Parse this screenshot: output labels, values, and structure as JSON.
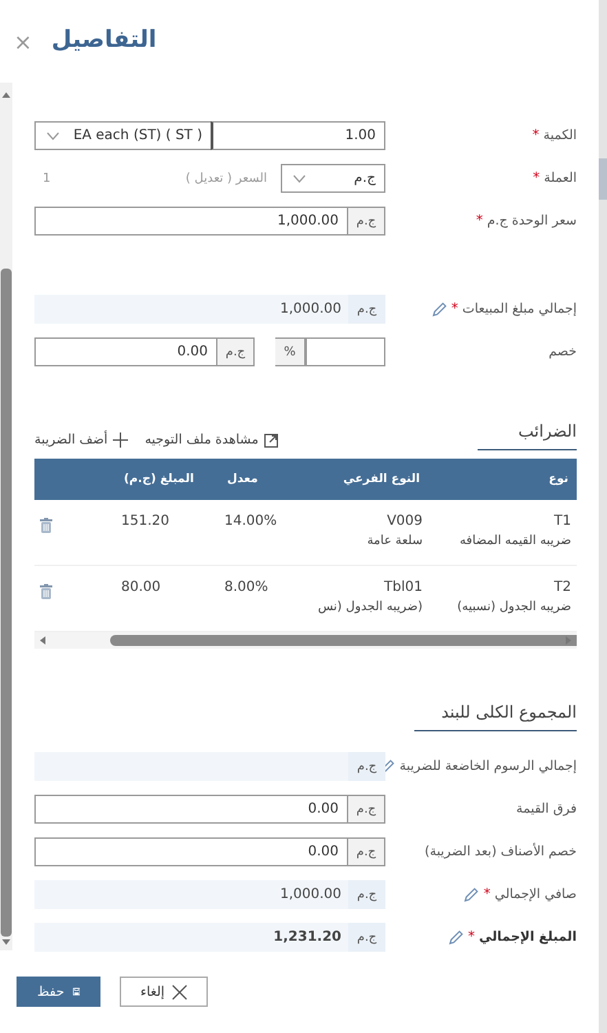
{
  "title": "التفاصيل",
  "close": "×",
  "fields": [
    {
      "kind": "unit_qty",
      "label": "الكمية",
      "mark": "*",
      "value": "1.00",
      "unit": "EA each (ST) ( ST )"
    },
    {
      "kind": "currency",
      "label": "العملة",
      "mark": "*",
      "value": "ج.م",
      "rate_label": "السعر ( تعديل )",
      "rate_value": "1",
      "rate_disabled": true
    },
    {
      "kind": "addon",
      "label": "سعر الوحدة ج.م",
      "mark": "*",
      "addon": "ج.م",
      "value": "1,000.00"
    },
    {
      "kind": "readonly",
      "label": "إجمالي مبلغ المبيعات",
      "mark": "*",
      "addon": "ج.م",
      "value": "1,000.00"
    },
    {
      "kind": "discount",
      "label": "خصم",
      "percent": "%",
      "addon": "ج.م",
      "value": "0.00"
    }
  ],
  "taxes": {
    "title": "الضرائب",
    "actions": [
      {
        "kind": "external",
        "label": "مشاهدة ملف التوجيه"
      },
      {
        "kind": "plus",
        "label": "أضف الضريبة"
      }
    ],
    "columns": [
      "نوع",
      "النوع الفرعي",
      "معدل",
      "المبلغ (ج.م)"
    ],
    "rows": [
      {
        "type": "T1",
        "type_name": "ضريبه القيمه المضافه",
        "subtype": "V009",
        "subtype_name": "سلعة عامة",
        "rate": "14.00%",
        "amount": "151.20"
      },
      {
        "type": "T2",
        "type_name": "ضريبه الجدول (نسبيه)",
        "subtype": "Tbl01",
        "subtype_name": "(ضريبه الجدول (نس",
        "rate": "8.00%",
        "amount": "80.00"
      }
    ]
  },
  "totals": {
    "title": "المجموع الكلى للبند",
    "fields": [
      {
        "kind": "readonly",
        "label": "إجمالي الرسوم الخاضعة للضريبة",
        "addon": "ج.م",
        "emphasis": false
      },
      {
        "kind": "addon",
        "label": "فرق القيمة",
        "addon": "ج.م",
        "value": "0.00"
      },
      {
        "kind": "addon",
        "label": "خصم الأصناف (بعد الضريبة)",
        "addon": "ج.م",
        "value": "0.00"
      },
      {
        "kind": "readonly",
        "label": "صافي الإجمالي",
        "mark": "*",
        "addon": "ج.م",
        "value": "1,000.00",
        "emphasis": false
      },
      {
        "kind": "readonly",
        "label": "المبلغ الإجمالي",
        "mark": "*",
        "addon": "ج.م",
        "value": "1,231.20",
        "emphasis": true
      }
    ]
  },
  "buttons": [
    {
      "kind": "cancel",
      "label": "إلغاء",
      "primary": false
    },
    {
      "kind": "save",
      "label": "حفظ",
      "primary": true
    }
  ]
}
